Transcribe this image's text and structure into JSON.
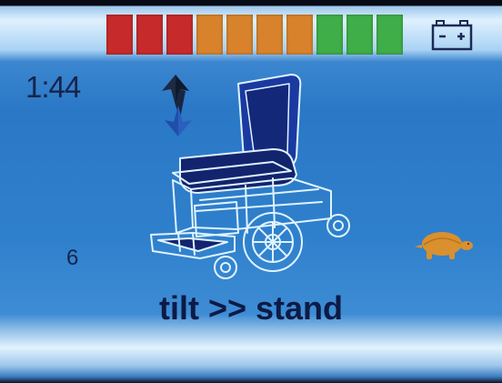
{
  "status_bar": {
    "battery_segments": [
      "#c62a2a",
      "#c62a2a",
      "#c62a2a",
      "#d8832c",
      "#d8832c",
      "#d8832c",
      "#d8832c",
      "#3fae48",
      "#3fae48",
      "#3fae48"
    ],
    "battery_icon": "battery-icon"
  },
  "main": {
    "clock": "1:44",
    "speed_level": "6",
    "mode_label": "tilt >> stand",
    "actuator_icon": "up-down-arrows-icon",
    "chair_graphic": "power-wheelchair-icon",
    "speed_mode_icon": "turtle-icon"
  },
  "colors": {
    "screen_blue": "#2a78c6",
    "text_dark": "#0d1a45",
    "turtle": "#d9902e"
  }
}
